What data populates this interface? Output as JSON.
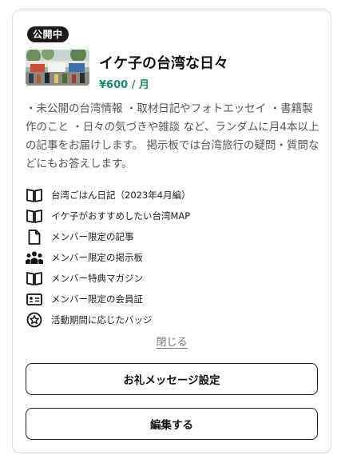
{
  "plan": {
    "badge": "公開中",
    "title": "イケ子の台湾な日々",
    "price": "¥600 / 月",
    "description": "・未公開の台湾情報 ・取材日記やフォトエッセイ ・書籍製作のこと ・日々の気づきや雑談 など、ランダムに月4本以上の記事をお届けします。 掲示板では台湾旅行の疑問・質問などにもお答えします。"
  },
  "features": [
    {
      "icon": "book-icon",
      "label": "台湾ごはん日記（2023年4月編）"
    },
    {
      "icon": "book-icon",
      "label": "イケ子がおすすめしたい台湾MAP"
    },
    {
      "icon": "document-icon",
      "label": "メンバー限定の記事"
    },
    {
      "icon": "people-icon",
      "label": "メンバー限定の掲示板"
    },
    {
      "icon": "book-icon",
      "label": "メンバー特典マガジン"
    },
    {
      "icon": "id-card-icon",
      "label": "メンバー限定の会員証"
    },
    {
      "icon": "badge-star-icon",
      "label": "活動期間に応じたバッジ"
    }
  ],
  "actions": {
    "close_label": "閉じる",
    "thanks_message_label": "お礼メッセージ設定",
    "edit_label": "編集する"
  },
  "colors": {
    "price": "#1b8a6b",
    "badge_bg": "#1b1b1b"
  }
}
